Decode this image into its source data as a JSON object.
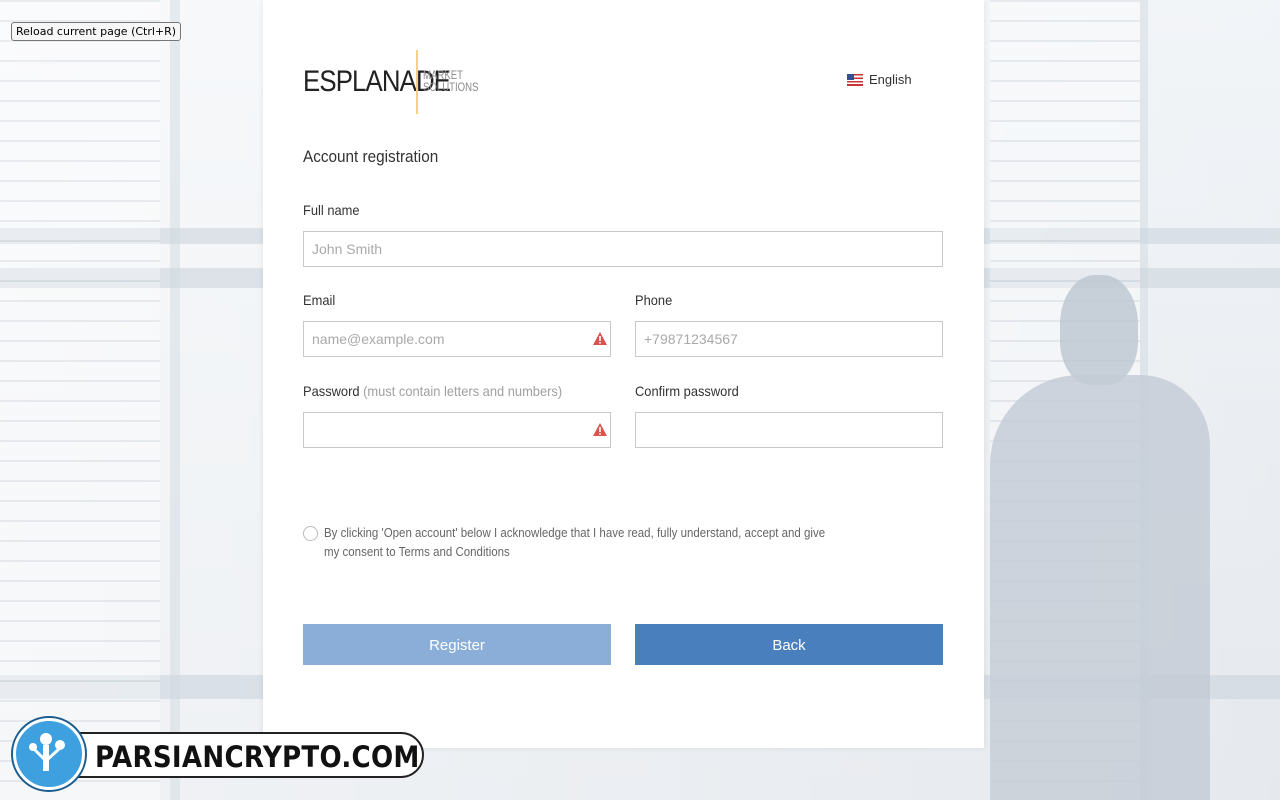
{
  "browser": {
    "reload_label": "Reload current page (Ctrl+R)"
  },
  "header": {
    "brand": "ESPLANADE",
    "brand_sub_line1": "MARKET",
    "brand_sub_line2": "SOLUTIONS",
    "language": "English",
    "language_icon": "us-flag-icon"
  },
  "form": {
    "title": "Account registration",
    "full_name": {
      "label": "Full name",
      "placeholder": "John Smith",
      "value": ""
    },
    "email": {
      "label": "Email",
      "placeholder": "name@example.com",
      "value": "",
      "status_icon": "warning-icon"
    },
    "phone": {
      "label": "Phone",
      "placeholder": "+79871234567",
      "value": ""
    },
    "password": {
      "label": "Password",
      "hint": "(must contain letters and numbers)",
      "value": "",
      "status_icon": "warning-icon"
    },
    "confirm_password": {
      "label": "Confirm password",
      "value": ""
    },
    "consent_text": "By clicking 'Open account' below I acknowledge that I have read, fully understand, accept and give my consent to Terms and Conditions",
    "register_label": "Register",
    "back_label": "Back"
  },
  "watermark": {
    "text": "PARSIANCRYPTO.COM"
  },
  "colors": {
    "register_button": "#8aaed8",
    "back_button": "#4a7fbe",
    "warning": "#d9534f",
    "logo_separator": "#f3d27a"
  }
}
